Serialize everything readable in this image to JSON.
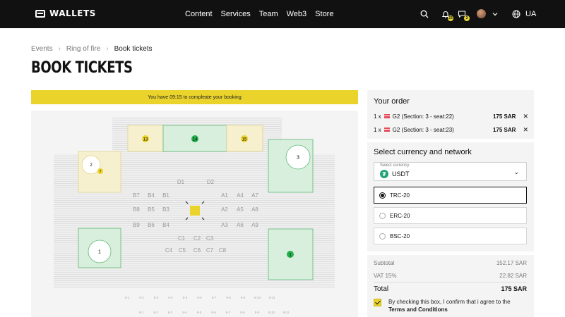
{
  "header": {
    "logo": "WALLETS",
    "nav": [
      "Content",
      "Services",
      "Team",
      "Web3",
      "Store"
    ],
    "notifications_count": "23",
    "messages_count": "2",
    "language": "UA",
    "icons": [
      "search-icon",
      "bell-icon",
      "chat-icon",
      "avatar",
      "chevron-down-icon",
      "globe-icon"
    ]
  },
  "breadcrumb": [
    "Events",
    "Ring of fire",
    "Book tickets"
  ],
  "page_title": "BOOK TICKETS",
  "timer": {
    "text": "You have 09:15 to compleate your booking"
  },
  "seat_map": {
    "sections": [
      "13",
      "14",
      "15",
      "2",
      "3",
      "1",
      "1"
    ],
    "small_badges": [
      "7"
    ],
    "left_seats": [
      [
        "B7",
        "B4",
        "B1"
      ],
      [
        "B8",
        "B5",
        "B3"
      ],
      [
        "B9",
        "B6",
        "B4"
      ]
    ],
    "right_seats": [
      [
        "A1",
        "A4",
        "A7"
      ],
      [
        "A2",
        "A5",
        "A8"
      ],
      [
        "A3",
        "A6",
        "A9"
      ]
    ],
    "top_seats": [
      "D1",
      "D2"
    ],
    "bottom_seats": [
      [
        "C1",
        "C2",
        "C3"
      ],
      [
        "C4",
        "C5",
        "C6",
        "C7",
        "C8"
      ]
    ],
    "row_labels": [
      "8-1",
      "8-2",
      "8-3",
      "8-4",
      "8-5",
      "8-6",
      "8-7",
      "8-8",
      "8-9",
      "8-10",
      "8-11"
    ]
  },
  "order": {
    "title": "Your order",
    "items": [
      {
        "qty": "1 x",
        "seat": "G2 (Section: 3 - seat:22)",
        "price": "175 SAR"
      },
      {
        "qty": "1 x",
        "seat": "G2 (Section: 3 - seat:23)",
        "price": "175 SAR"
      }
    ]
  },
  "currency": {
    "title": "Select currency and network",
    "select_label": "Select currency",
    "selected": "USDT",
    "networks": [
      {
        "label": "TRC-20",
        "selected": true
      },
      {
        "label": "ERC-20",
        "selected": false
      },
      {
        "label": "BSC-20",
        "selected": false
      }
    ]
  },
  "summary": {
    "subtotal_label": "Subtotal",
    "subtotal": "152.17 SAR",
    "vat_label": "VAT 15%",
    "vat": "22.82 SAR",
    "total_label": "Total",
    "total": "175 SAR"
  },
  "agreement": {
    "text": "By checking this box, I confirm that i agree to the",
    "link": "Terms and Conditions",
    "checked": true
  },
  "colors": {
    "accent": "#ead32a",
    "section_green": "#d9efde",
    "section_yellow": "#f6f0cf",
    "available": "#27ae4f"
  }
}
